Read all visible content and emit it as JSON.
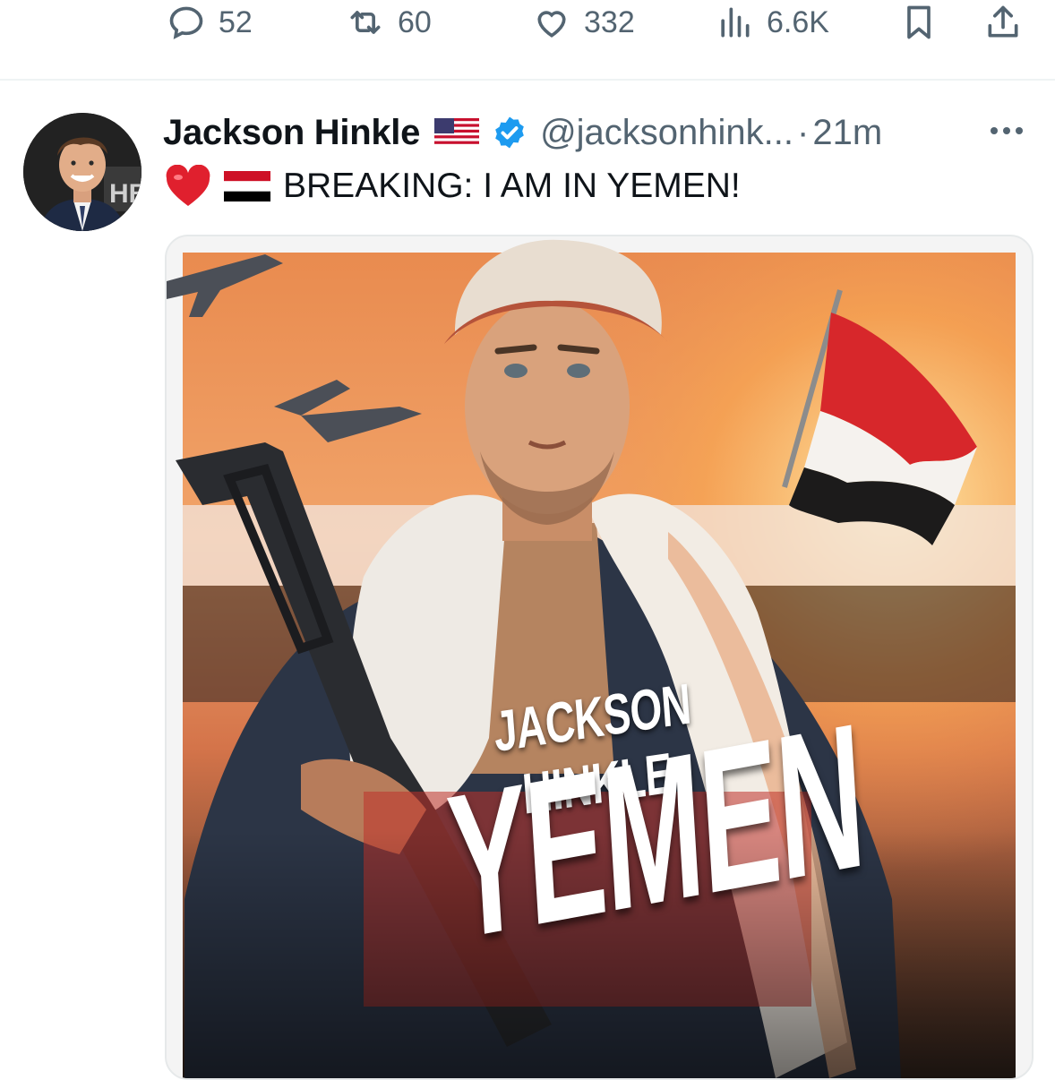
{
  "actions": {
    "reply_count": "52",
    "retweet_count": "60",
    "like_count": "332",
    "views_count": "6.6K",
    "icons": [
      "reply-icon",
      "retweet-icon",
      "like-icon",
      "views-icon",
      "bookmark-icon",
      "share-icon"
    ]
  },
  "tweet": {
    "author_name": "Jackson Hinkle",
    "handle": "@jacksonhink...",
    "separator": "·",
    "time": "21m",
    "text": "BREAKING: I AM IN YEMEN!",
    "badges": [
      "us-flag-emoji",
      "verified-badge-icon"
    ],
    "text_emojis": [
      "red-heart-emoji",
      "yemen-flag-emoji"
    ],
    "media": {
      "poster_name_text": "JACKSON HINKLE",
      "poster_country_text": "YEMEN"
    }
  },
  "colors": {
    "text": "#0f1419",
    "secondary": "#536471",
    "verified": "#1d9bf0",
    "divider": "#eff3f4"
  }
}
